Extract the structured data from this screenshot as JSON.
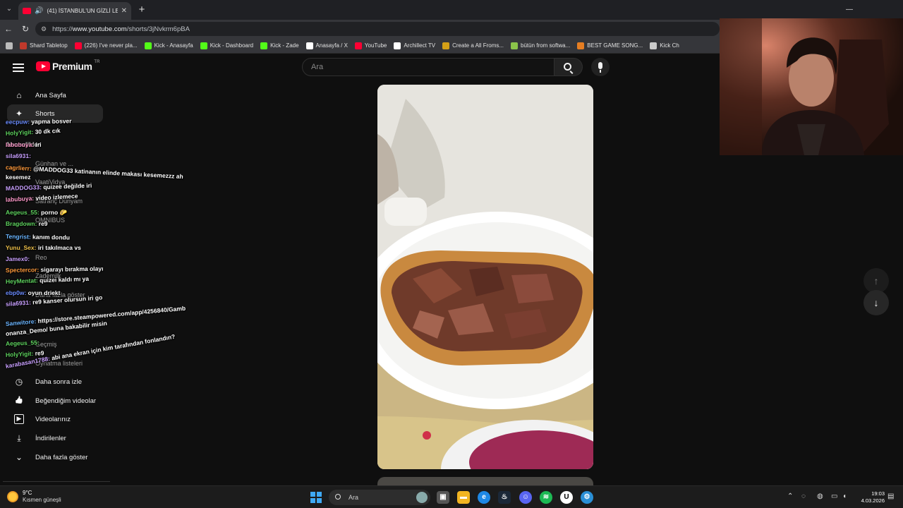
{
  "browser": {
    "tab_title": "(41) İSTANBUL'UN GİZLİ LEZZ",
    "url_prefix": "https://",
    "url_host": "www.youtube.com",
    "url_path": "/shorts/3jNvkrm6pBA",
    "bookmarks": [
      {
        "label": "Shard Tabletop",
        "color": "#c0392b",
        "icon": "shard-icon"
      },
      {
        "label": "(226) I've never pla...",
        "color": "#ff0033",
        "icon": "youtube-icon"
      },
      {
        "label": "Kick - Anasayfa",
        "color": "#53fc18",
        "icon": "kick-icon"
      },
      {
        "label": "Kick - Dashboard",
        "color": "#53fc18",
        "icon": "kick-icon"
      },
      {
        "label": "Kick - Zade",
        "color": "#53fc18",
        "icon": "kick-icon"
      },
      {
        "label": "Anasayfa / X",
        "color": "#ffffff",
        "icon": "x-icon"
      },
      {
        "label": "YouTube",
        "color": "#ff0033",
        "icon": "youtube-icon"
      },
      {
        "label": "Archillect TV",
        "color": "#ffffff",
        "icon": "archillect-icon"
      },
      {
        "label": "Create a All Froms...",
        "color": "#d4a017",
        "icon": "create-icon"
      },
      {
        "label": "bütün from softwa...",
        "color": "#8bc34a",
        "icon": "leaf-icon"
      },
      {
        "label": "BEST GAME SONG...",
        "color": "#e67e22",
        "icon": "music-icon"
      },
      {
        "label": "Kick Ch",
        "color": "#cccccc",
        "icon": "globe-icon"
      }
    ]
  },
  "youtube": {
    "logo_word": "Premium",
    "region": "TR",
    "search_placeholder": "Ara"
  },
  "sidebar": {
    "items": [
      {
        "label": "Ana Sayfa",
        "icon": "home-icon",
        "glyph": "⌂"
      },
      {
        "label": "Shorts",
        "icon": "shorts-icon",
        "glyph": "✦"
      }
    ],
    "ghost_items": [
      "Abonelikler",
      "Günhan ve ...",
      "VaatiVidya",
      "Satranç Dünyam",
      "OMNIBUS",
      "Reo",
      "Zademilk",
      "Daha fazla göster",
      "Geçmiş",
      "Oynatma listeleri"
    ],
    "lower_items": [
      {
        "label": "Daha sonra izle",
        "icon": "clock-icon",
        "glyph": "◷"
      },
      {
        "label": "Beğendiğim videolar",
        "icon": "thumbs-up-icon",
        "glyph": "👍"
      },
      {
        "label": "Videolarınız",
        "icon": "video-icon",
        "glyph": "▶"
      },
      {
        "label": "İndirilenler",
        "icon": "download-icon",
        "glyph": "⤓"
      },
      {
        "label": "Daha fazla göster",
        "icon": "chevron-down-icon",
        "glyph": "⌄"
      }
    ]
  },
  "chat": [
    {
      "user": "eecpuw:",
      "msg": "yapma bosver",
      "color": "#6b8cff"
    },
    {
      "user": "HolyYigit:",
      "msg": "30 dk cık",
      "color": "#5fd35f"
    },
    {
      "user": "labubuya:",
      "msg": "iri",
      "color": "#ff9acb"
    },
    {
      "user": "sila6931:",
      "msg": "",
      "color": "#c9a0ff"
    },
    {
      "user": "cagrlierr:",
      "msg": "@MADDOG33 katinanın elinde makası kesemezzz ah",
      "color": "#ff9a3c"
    },
    {
      "user": "kesemez",
      "msg": "",
      "color": "#ffffff"
    },
    {
      "user": "MADDOG33:",
      "msg": "quizee değilde iri",
      "color": "#c9a0ff"
    },
    {
      "user": "labubuya:",
      "msg": "video izlemece",
      "color": "#ff9acb"
    },
    {
      "user": "Aegeus_55:",
      "msg": "porno 🌮",
      "color": "#5fd35f"
    },
    {
      "user": "Bragdown:",
      "msg": "re9",
      "color": "#5fd35f"
    },
    {
      "user": "Tengrist:",
      "msg": "kanım dondu",
      "color": "#6bb5ff"
    },
    {
      "user": "Yunu_Sex:",
      "msg": "iri takılmaca vs",
      "color": "#f0c24b"
    },
    {
      "user": "Jamex0:",
      "msg": "",
      "color": "#c9a0ff"
    },
    {
      "user": "Spectercor:",
      "msg": "sigarayı bırakma olayı",
      "color": "#ff9a3c"
    },
    {
      "user": "HeyMentat:",
      "msg": "quizei kaldı mı ya",
      "color": "#5fd35f"
    },
    {
      "user": "ebp0w:",
      "msg": "oyun driekt",
      "color": "#6b8cff"
    },
    {
      "user": "sila6931:",
      "msg": "re9 kanser olursun iri go",
      "color": "#c9a0ff"
    },
    {
      "user": "Sanwitore:",
      "msg": "https://store.steampowered.com/app/4256840/Gamb",
      "color": "#6bb5ff"
    },
    {
      "user": "onanza_Demo/",
      "msg": "buna bakabilir misin",
      "color": "#ffffff"
    },
    {
      "user": "Aegeus_55:",
      "msg": "",
      "color": "#5fd35f"
    },
    {
      "user": "HolyYigit:",
      "msg": "re9",
      "color": "#5fd35f"
    },
    {
      "user": "karabasan1788:",
      "msg": "abi ana ekran için kim tarafından fonlandın?",
      "color": "#c9a0ff"
    }
  ],
  "nav": {
    "up": "↑",
    "down": "↓"
  },
  "taskbar": {
    "temperature": "9°C",
    "condition": "Kısmen güneşli",
    "search": "Ara",
    "time": "19:03",
    "date": "4.03.2026"
  }
}
